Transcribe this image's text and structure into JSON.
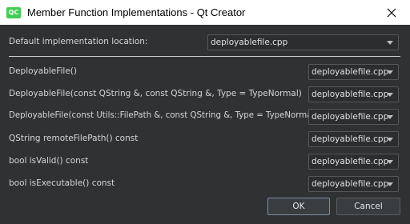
{
  "window": {
    "title": "Member Function Implementations - Qt Creator",
    "app_icon_text": "QC"
  },
  "default": {
    "label": "Default implementation location:",
    "value": "deployablefile.cpp"
  },
  "functions": [
    {
      "signature": "DeployableFile()",
      "location": "deployablefile.cpp"
    },
    {
      "signature": "DeployableFile(const QString &, const QString &, Type = TypeNormal)",
      "location": "deployablefile.cpp"
    },
    {
      "signature": "DeployableFile(const Utils::FilePath &, const QString &, Type = TypeNormal)",
      "location": "deployablefile.cpp"
    },
    {
      "signature": "QString remoteFilePath() const",
      "location": "deployablefile.cpp"
    },
    {
      "signature": "bool isValid() const",
      "location": "deployablefile.cpp"
    },
    {
      "signature": "bool isExecutable() const",
      "location": "deployablefile.cpp"
    }
  ],
  "buttons": {
    "ok": "OK",
    "cancel": "Cancel"
  },
  "colors": {
    "background": "#2f3133",
    "accent_icon": "#41cd52"
  }
}
